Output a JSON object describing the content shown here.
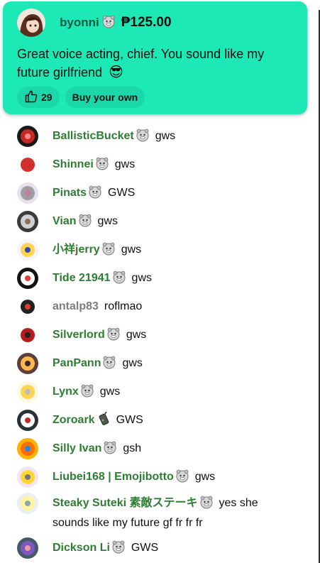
{
  "superchat": {
    "author": "byonni",
    "amount": "₱125.00",
    "message": "Great voice acting, chief. You sound like my future girlfriend",
    "emoji": "😎",
    "like_count": "29",
    "buy_label": "Buy your own",
    "color": "#1de9b6"
  },
  "messages": [
    {
      "author": "BallisticBucket",
      "text": "gws"
    },
    {
      "author": "Shinnei",
      "text": "gws"
    },
    {
      "author": "Pinats",
      "text": "GWS"
    },
    {
      "author": "Vian",
      "text": "gws"
    },
    {
      "author": "小祥jerry",
      "text": "gws"
    },
    {
      "author": "Tide 21941",
      "text": "gws"
    },
    {
      "author": "antalp83",
      "text": "roflmao"
    },
    {
      "author": "Silverlord",
      "text": "gws"
    },
    {
      "author": "PanPann",
      "text": "gws"
    },
    {
      "author": "Lynx",
      "text": "gws"
    },
    {
      "author": "Zoroark",
      "text": "GWS"
    },
    {
      "author": "Silly Ivan",
      "text": "gsh"
    },
    {
      "author": "Liubei168 | Emojibotto",
      "text": "gws"
    },
    {
      "author": "Steaky Suteki 素敵ステーキ",
      "text": "yes she sounds like my future gf fr fr fr"
    },
    {
      "author": "Dickson Li",
      "text": "GWS"
    }
  ],
  "colors": {
    "member_name": "#2e7d32",
    "non_member_name": "#7d7d7d"
  },
  "icons": {
    "member_badge": "member-badge-icon",
    "like": "thumbs-up-icon"
  }
}
